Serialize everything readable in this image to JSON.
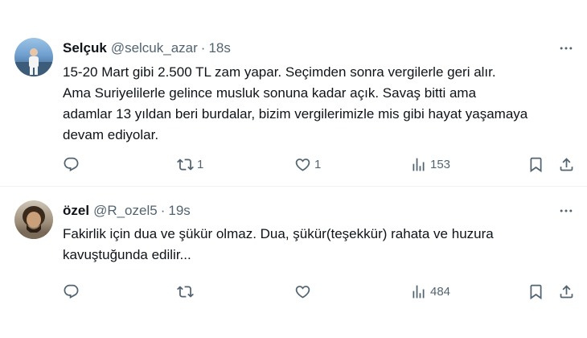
{
  "tweets": [
    {
      "name": "Selçuk",
      "handle": "@selcuk_azar",
      "dot": "·",
      "time": "18s",
      "lines": [
        "15-20 Mart gibi 2.500 TL zam yapar. Seçimden sonra vergilerle geri alır.",
        "Ama Suriyelilerle gelince musluk sonuna kadar açık. Savaş bitti ama",
        "adamlar 13 yıldan beri burdalar, bizim vergilerimizle mis gibi hayat yaşamaya",
        "devam ediyolar."
      ],
      "retweets": "1",
      "likes": "1",
      "views": "153"
    },
    {
      "name": "özel",
      "handle": "@R_ozel5",
      "dot": "·",
      "time": "19s",
      "lines": [
        "Fakirlik için dua ve şükür olmaz. Dua, şükür(teşekkür) rahata ve huzura",
        "kavuştuğunda edilir..."
      ],
      "retweets": "",
      "likes": "",
      "views": "484"
    }
  ],
  "icons": {
    "reply": "reply-icon",
    "retweet": "retweet-icon",
    "like": "like-icon",
    "views": "views-icon",
    "bookmark": "bookmark-icon",
    "share": "share-icon",
    "more": "more-icon"
  }
}
